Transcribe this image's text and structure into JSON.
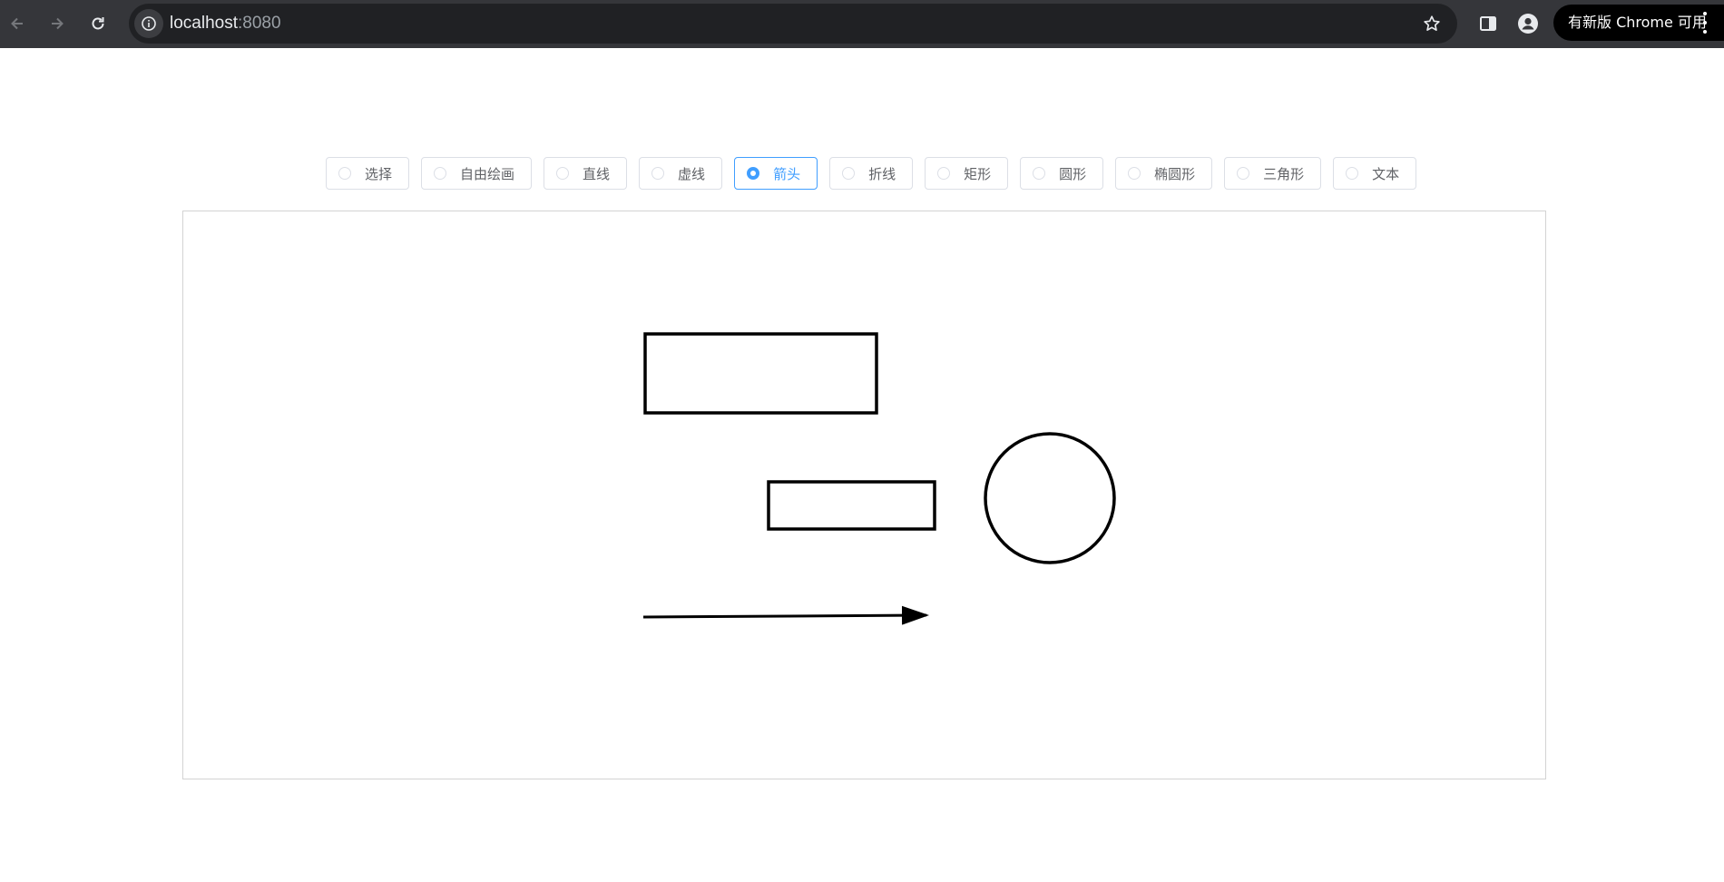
{
  "browser": {
    "url_host": "localhost",
    "url_port": ":8080",
    "update_label": "有新版 Chrome 可用",
    "icons": {
      "back": "arrow-left-icon",
      "forward": "arrow-right-icon",
      "reload": "reload-icon",
      "site_info": "info-icon",
      "bookmark": "star-icon",
      "side_panel": "side-panel-icon",
      "profile": "person-icon",
      "menu": "kebab-menu-icon"
    }
  },
  "toolbar": {
    "selected": "箭头",
    "tools": [
      {
        "label": "选择"
      },
      {
        "label": "自由绘画"
      },
      {
        "label": "直线"
      },
      {
        "label": "虚线"
      },
      {
        "label": "箭头"
      },
      {
        "label": "折线"
      },
      {
        "label": "矩形"
      },
      {
        "label": "圆形"
      },
      {
        "label": "椭圆形"
      },
      {
        "label": "三角形"
      },
      {
        "label": "文本"
      }
    ],
    "accent_color": "#409eff"
  },
  "canvas": {
    "shapes": [
      "rectangle",
      "rectangle",
      "circle",
      "arrow"
    ],
    "stroke_color": "#000000"
  }
}
